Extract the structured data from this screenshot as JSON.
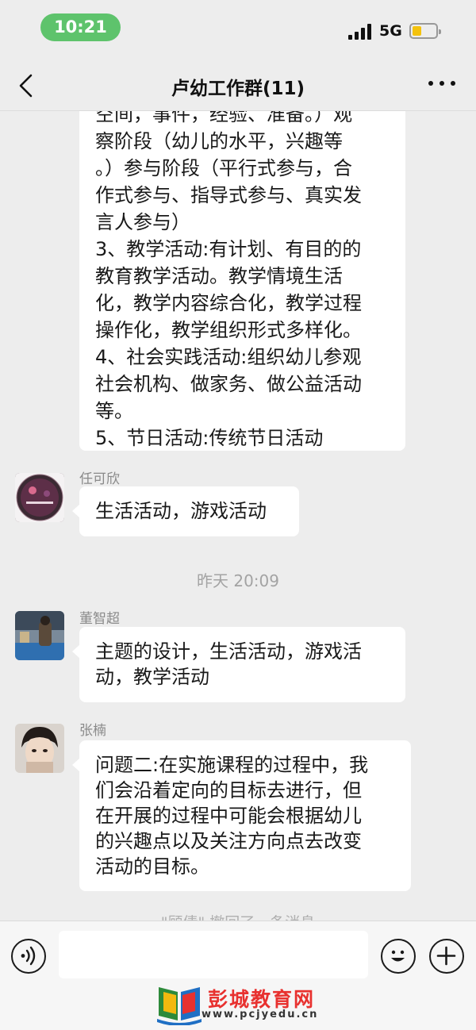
{
  "status_bar": {
    "time": "10:21",
    "network": "5G"
  },
  "header": {
    "title": "卢幼工作群(11)"
  },
  "messages": {
    "first": {
      "lines": [
        "空间，事件，经验、准备。）观",
        "察阶段（幼儿的水平，兴趣等",
        "。）参与阶段（平行式参与，合",
        "作式参与、指导式参与、真实发",
        "言人参与）",
        "3、教学活动:有计划、有目的的",
        "教育教学活动。教学情境生活",
        "化，教学内容综合化，教学过程",
        "操作化，教学组织形式多样化。",
        "4、社会实践活动:组织幼儿参观",
        "社会机构、做家务、做公益活动",
        "等。",
        "5、节日活动:传统节日活动"
      ]
    },
    "renkexin": {
      "sender": "任可欣",
      "lines": [
        "生活活动，游戏活动"
      ]
    },
    "timestamp": "昨天 20:09",
    "dongzhichao": {
      "sender": "董智超",
      "lines": [
        "主题的设计，生活活动，游戏活",
        "动，教学活动"
      ]
    },
    "zhangnan": {
      "sender": "张楠",
      "lines": [
        "问题二:在实施课程的过程中，我",
        "们会沿着定向的目标去进行，但",
        "在开展的过程中可能会根据幼儿",
        "的兴趣点以及关注方向点去改变",
        "活动的目标。"
      ]
    },
    "recall_notice": "\"顾倩\" 撤回了一条消息"
  },
  "input_bar": {
    "value": "",
    "placeholder": ""
  },
  "watermark": {
    "name": "彭城教育网",
    "url": "www.pcjyedu.cn"
  },
  "colors": {
    "time_pill": "#5ec36c",
    "background": "#ededed",
    "bubble": "#ffffff",
    "watermark_red": "#e8312f"
  }
}
